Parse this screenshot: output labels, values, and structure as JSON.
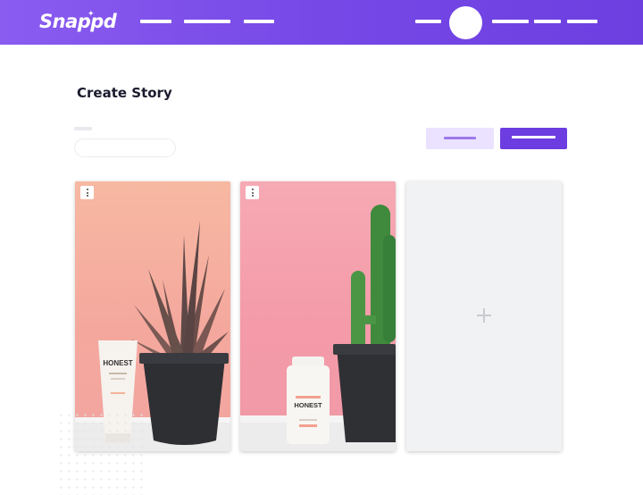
{
  "header": {
    "logo_text": "Snappd",
    "accent_color": "#7648e6"
  },
  "main": {
    "title": "Create Story",
    "product_label_card_1": "HONEST",
    "product_label_card_2": "HONEST"
  },
  "icons": {
    "card_menu": "more-vertical-icon",
    "add_card": "plus-icon"
  },
  "colors": {
    "primary_button": "#6c3de0",
    "secondary_button": "#ebe2ff",
    "card_1_background": "#f7b8a2",
    "card_2_background": "#f6aab4",
    "add_card_background": "#f1f2f4"
  }
}
